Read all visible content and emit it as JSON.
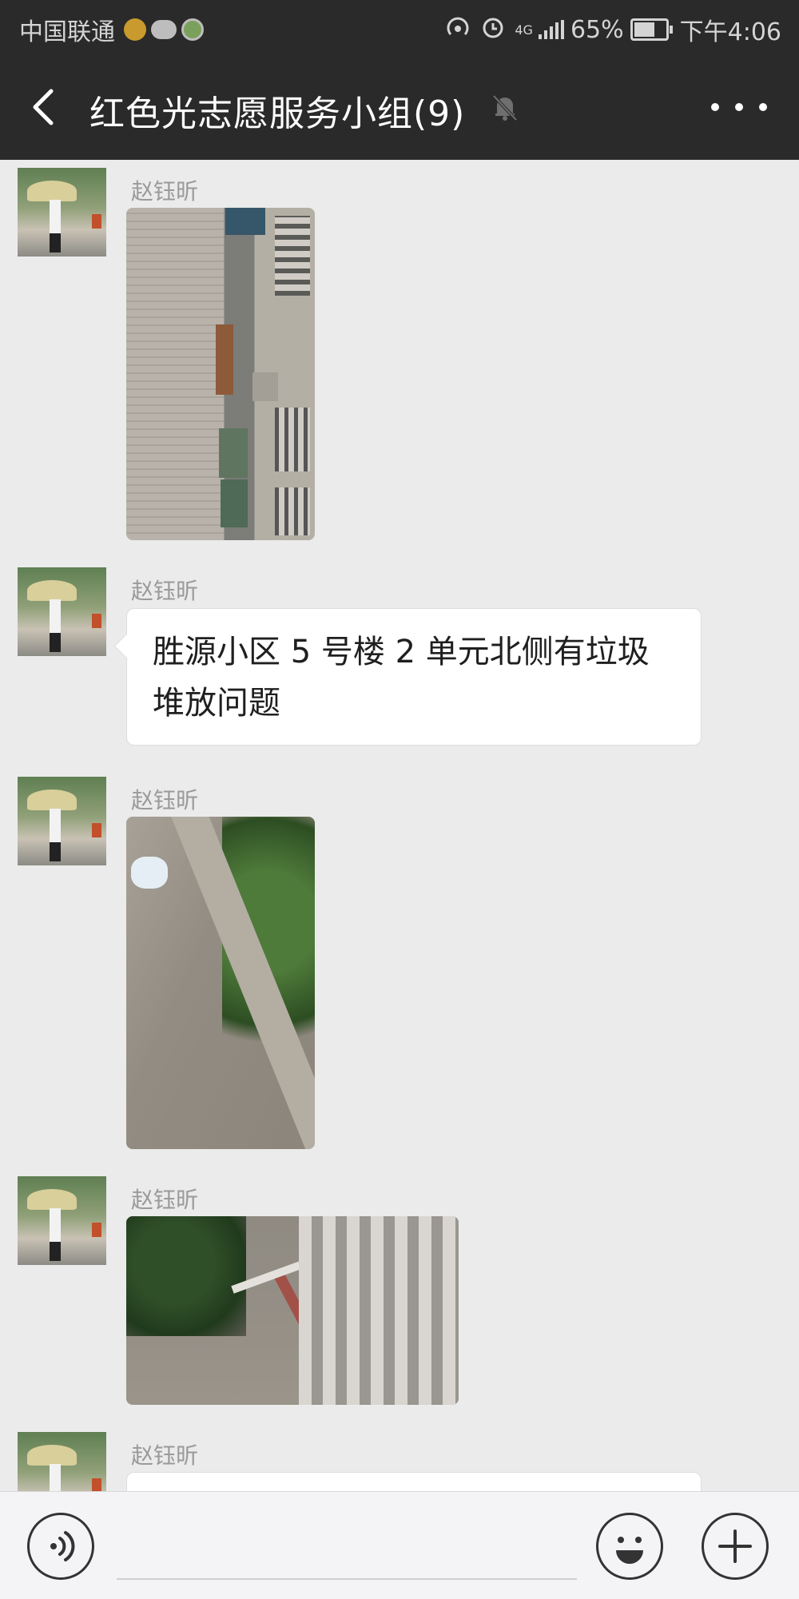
{
  "status_bar": {
    "carrier": "中国联通",
    "battery": "65%",
    "time": "下午4:06",
    "network_type": "4G",
    "app_icons": [
      "mail-icon",
      "wechat-icon",
      "app-icon"
    ],
    "right_icons": [
      "hotspot-icon",
      "alarm-icon",
      "signal-icon",
      "battery-icon"
    ]
  },
  "header": {
    "title": "红色光志愿服务小组(9)",
    "back_icon": "chevron-left-icon",
    "mute_icon": "bell-muted-icon",
    "more_icon": "more-icon"
  },
  "messages": [
    {
      "type": "image",
      "sender": "赵钰昕",
      "image_desc": "street-photo"
    },
    {
      "type": "text",
      "sender": "赵钰昕",
      "text": "胜源小区 5 号楼 2 单元北侧有垃圾堆放问题"
    },
    {
      "type": "image",
      "sender": "赵钰昕",
      "image_desc": "curb-photo"
    },
    {
      "type": "image",
      "sender": "赵钰昕",
      "image_desc": "railing-photo"
    },
    {
      "type": "text",
      "sender": "赵钰昕",
      "text": ""
    }
  ],
  "input_bar": {
    "voice_icon": "voice-icon",
    "emoji_icon": "emoji-icon",
    "plus_icon": "plus-icon"
  },
  "colors": {
    "header_bg": "#2a2a2a",
    "chat_bg": "#ebebeb",
    "bubble_bg": "#ffffff",
    "sender_text": "#9a9a9a"
  }
}
